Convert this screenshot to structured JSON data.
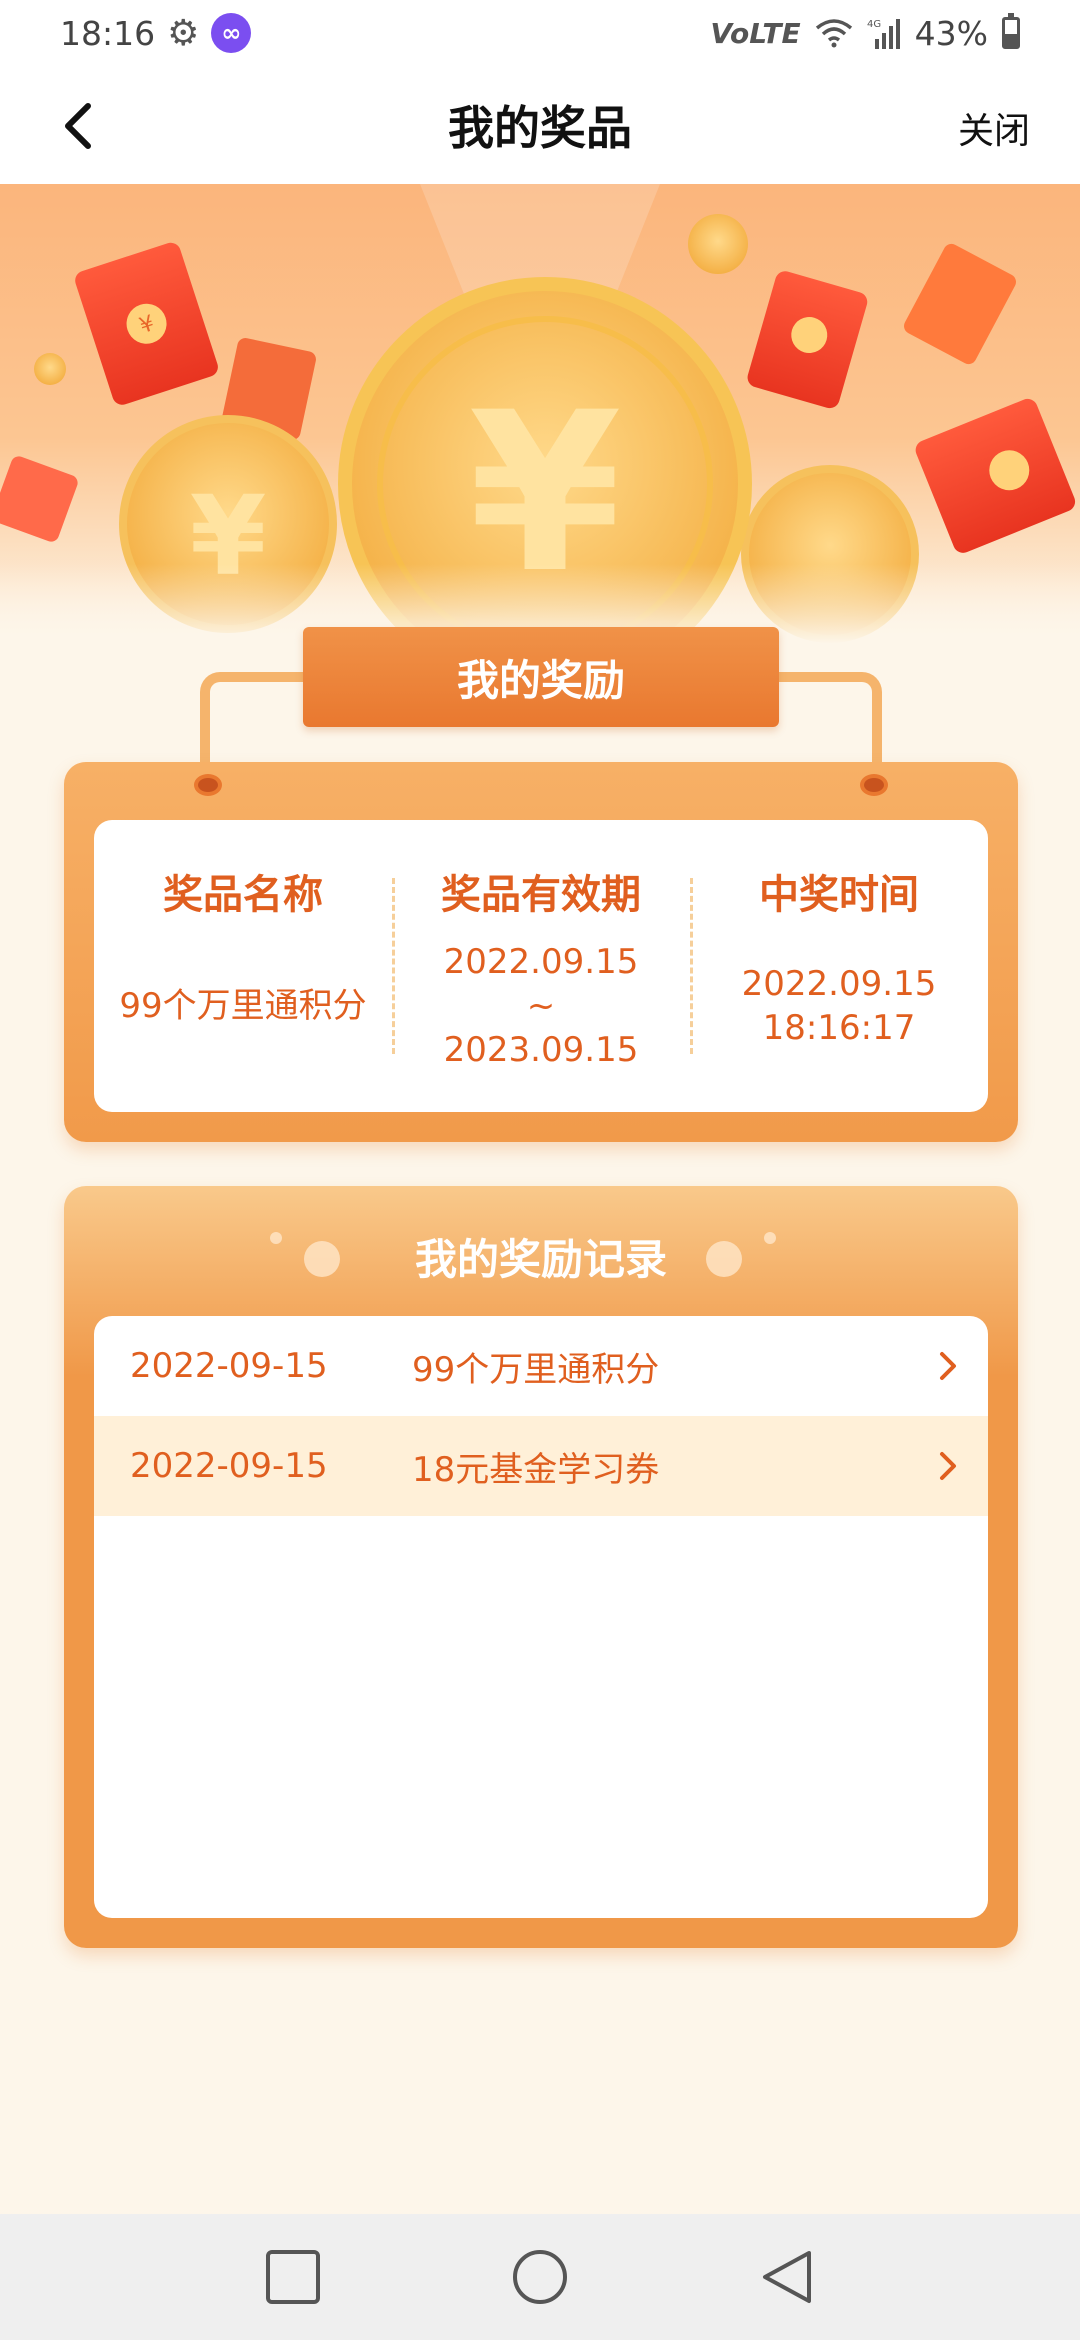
{
  "status_bar": {
    "time": "18:16",
    "network": "VoLTE",
    "signal": "4G",
    "battery": "43%"
  },
  "nav": {
    "title": "我的奖品",
    "close_label": "关闭"
  },
  "reward": {
    "section_title": "我的奖励",
    "columns": [
      {
        "header": "奖品名称",
        "lines": [
          "99个万里通积分"
        ]
      },
      {
        "header": "奖品有效期",
        "lines": [
          "2022.09.15",
          "~",
          "2023.09.15"
        ]
      },
      {
        "header": "中奖时间",
        "lines": [
          "2022.09.15",
          "18:16:17"
        ]
      }
    ]
  },
  "records": {
    "section_title": "我的奖励记录",
    "items": [
      {
        "date": "2022-09-15",
        "name": "99个万里通积分"
      },
      {
        "date": "2022-09-15",
        "name": "18元基金学习券"
      }
    ]
  },
  "colors": {
    "accent": "#e05f1f",
    "card_orange": "#f09848",
    "banner": "#fbb57c",
    "row_highlight": "#fff0d8"
  }
}
